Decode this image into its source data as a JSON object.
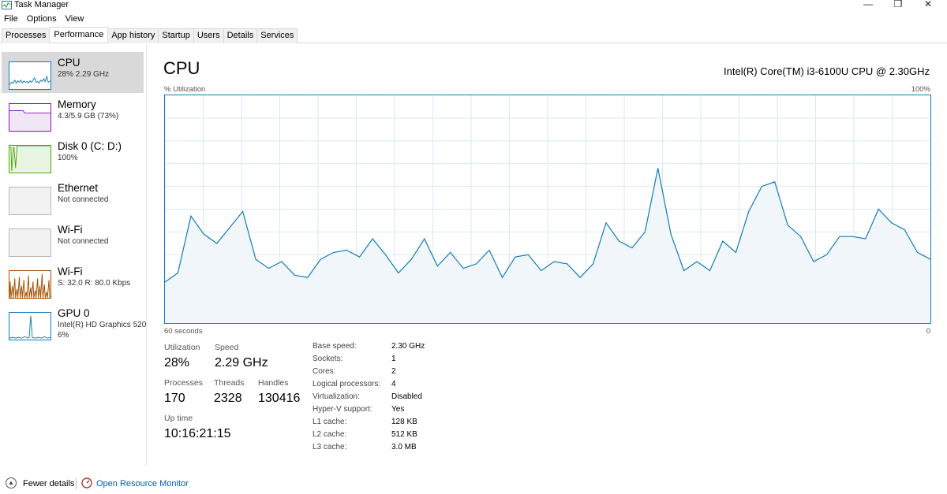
{
  "window": {
    "title": "Task Manager",
    "minimize": "—",
    "maximize": "❐",
    "close": "✕"
  },
  "menu": [
    "File",
    "Options",
    "View"
  ],
  "tabs": [
    "Processes",
    "Performance",
    "App history",
    "Startup",
    "Users",
    "Details",
    "Services"
  ],
  "active_tab": "Performance",
  "sidebar": [
    {
      "name": "CPU",
      "sub": "28% 2.29 GHz",
      "color": "#117dbb",
      "selected": true
    },
    {
      "name": "Memory",
      "sub": "4.3/5.9 GB (73%)",
      "color": "#8b12ae"
    },
    {
      "name": "Disk 0 (C: D:)",
      "sub": "100%",
      "color": "#4da60c"
    },
    {
      "name": "Ethernet",
      "sub": "Not connected",
      "color": "#a0a0a0"
    },
    {
      "name": "Wi-Fi",
      "sub": "Not connected",
      "color": "#a0a0a0"
    },
    {
      "name": "Wi-Fi",
      "sub": "S: 32.0  R: 80.0 Kbps",
      "color": "#a74f01"
    },
    {
      "name": "GPU 0",
      "sub": "Intel(R) HD Graphics 520",
      "sub2": "6%",
      "color": "#117dbb"
    }
  ],
  "main": {
    "title": "CPU",
    "model": "Intel(R) Core(TM) i3-6100U CPU @ 2.30GHz",
    "graph_label_top_left": "% Utilization",
    "graph_label_top_right": "100%",
    "graph_label_bottom_left": "60 seconds",
    "graph_label_bottom_right": "0"
  },
  "chart_data": {
    "type": "area",
    "ylabel": "% Utilization",
    "ylim": [
      0,
      100
    ],
    "xlabel": "60 seconds",
    "values": [
      18,
      22,
      47,
      39,
      35,
      42,
      49,
      28,
      24,
      27,
      21,
      20,
      28,
      31,
      32,
      29,
      37,
      30,
      22,
      28,
      37,
      25,
      31,
      24,
      26,
      32,
      20,
      29,
      30,
      23,
      27,
      26,
      20,
      26,
      44,
      36,
      33,
      40,
      68,
      39,
      23,
      27,
      23,
      36,
      31,
      49,
      60,
      62,
      43,
      38,
      27,
      30,
      38,
      38,
      37,
      50,
      44,
      41,
      31,
      28
    ],
    "color": "#117dbb"
  },
  "stats": {
    "utilization_label": "Utilization",
    "utilization": "28%",
    "speed_label": "Speed",
    "speed": "2.29 GHz",
    "processes_label": "Processes",
    "processes": "170",
    "threads_label": "Threads",
    "threads": "2328",
    "handles_label": "Handles",
    "handles": "130416",
    "uptime_label": "Up time",
    "uptime": "10:16:21:15"
  },
  "details": [
    {
      "label": "Base speed:",
      "value": "2.30 GHz"
    },
    {
      "label": "Sockets:",
      "value": "1"
    },
    {
      "label": "Cores:",
      "value": "2"
    },
    {
      "label": "Logical processors:",
      "value": "4"
    },
    {
      "label": "Virtualization:",
      "value": "Disabled"
    },
    {
      "label": "Hyper-V support:",
      "value": "Yes"
    },
    {
      "label": "L1 cache:",
      "value": "128 KB"
    },
    {
      "label": "L2 cache:",
      "value": "512 KB"
    },
    {
      "label": "L3 cache:",
      "value": "3.0 MB"
    }
  ],
  "footer": {
    "fewer_details": "Fewer details",
    "open_resource_monitor": "Open Resource Monitor"
  }
}
